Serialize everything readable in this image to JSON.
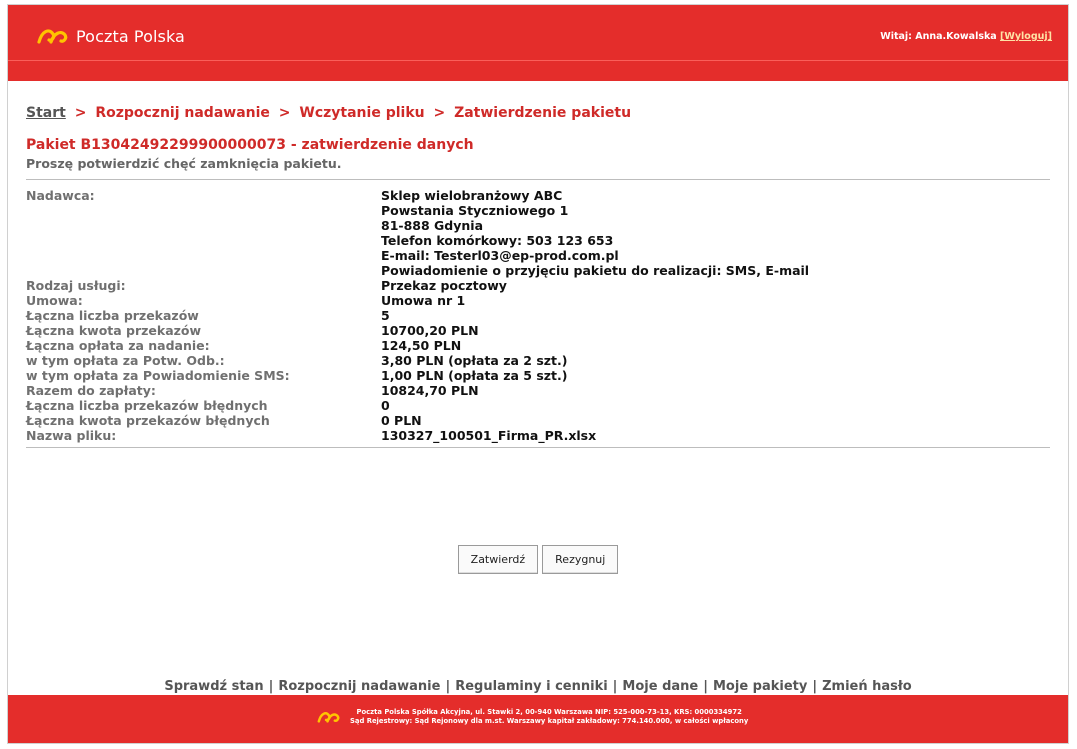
{
  "brand": {
    "name": "Poczta Polska"
  },
  "header": {
    "welcome_label": "Witaj: Anna.Kowalska",
    "logout_label": "[Wyloguj]"
  },
  "breadcrumb": {
    "start": "Start",
    "step1": "Rozpocznij nadawanie",
    "step2": "Wczytanie pliku",
    "step3": "Zatwierdzenie pakietu",
    "separator": ">"
  },
  "package": {
    "title_code": "Pakiet B13042492299900000073",
    "title_suffix": " - zatwierdzenie danych",
    "subtitle": "Proszę potwierdzić chęć zamknięcia pakietu."
  },
  "details": {
    "sender": {
      "label": "Nadawca:",
      "lines": [
        "Sklep wielobranżowy ABC",
        "Powstania Styczniowego 1",
        "81-888 Gdynia",
        "Telefon komórkowy: 503 123 653",
        "E-mail: Testerl03@ep-prod.com.pl",
        "Powiadomienie o przyjęciu pakietu do realizacji: SMS, E-mail"
      ]
    },
    "rows": [
      {
        "label": "Rodzaj usługi:",
        "value": "Przekaz pocztowy"
      },
      {
        "label": "Umowa:",
        "value": "Umowa nr 1"
      },
      {
        "label": "Łączna liczba przekazów",
        "value": "5"
      },
      {
        "label": "Łączna kwota przekazów",
        "value": "10700,20 PLN"
      },
      {
        "label": "Łączna opłata za nadanie:",
        "value": "124,50 PLN"
      },
      {
        "label": "w tym opłata za Potw. Odb.:",
        "value": "3,80 PLN (opłata za 2 szt.)"
      },
      {
        "label": "w tym opłata za Powiadomienie SMS:",
        "value": "1,00 PLN (opłata za 5 szt.)"
      },
      {
        "label": "Razem do zapłaty:",
        "value": "10824,70 PLN"
      },
      {
        "label": "Łączna liczba przekazów błędnych",
        "value": "0"
      },
      {
        "label": "Łączna kwota przekazów błędnych",
        "value": "0 PLN"
      },
      {
        "label": "Nazwa pliku:",
        "value": "130327_100501_Firma_PR.xlsx"
      }
    ]
  },
  "actions": {
    "confirm": "Zatwierdź",
    "cancel": "Rezygnuj"
  },
  "footer": {
    "links": [
      "Sprawdź stan",
      "Rozpocznij nadawanie",
      "Regulaminy i cenniki",
      "Moje dane",
      "Moje pakiety",
      "Zmień hasło"
    ],
    "separator": "|",
    "legal_line1": "Poczta Polska Spółka Akcyjna, ul. Stawki 2, 00-940 Warszawa NIP: 525-000-73-13, KRS: 0000334972",
    "legal_line2": "Sąd Rejestrowy: Sąd Rejonowy dla m.st. Warszawy kapitał zakładowy: 774.140.000, w całości wpłacony"
  },
  "colors": {
    "brand_red": "#e42d2b",
    "link_red": "#cf2a28",
    "logo_yellow": "#ffc400"
  }
}
